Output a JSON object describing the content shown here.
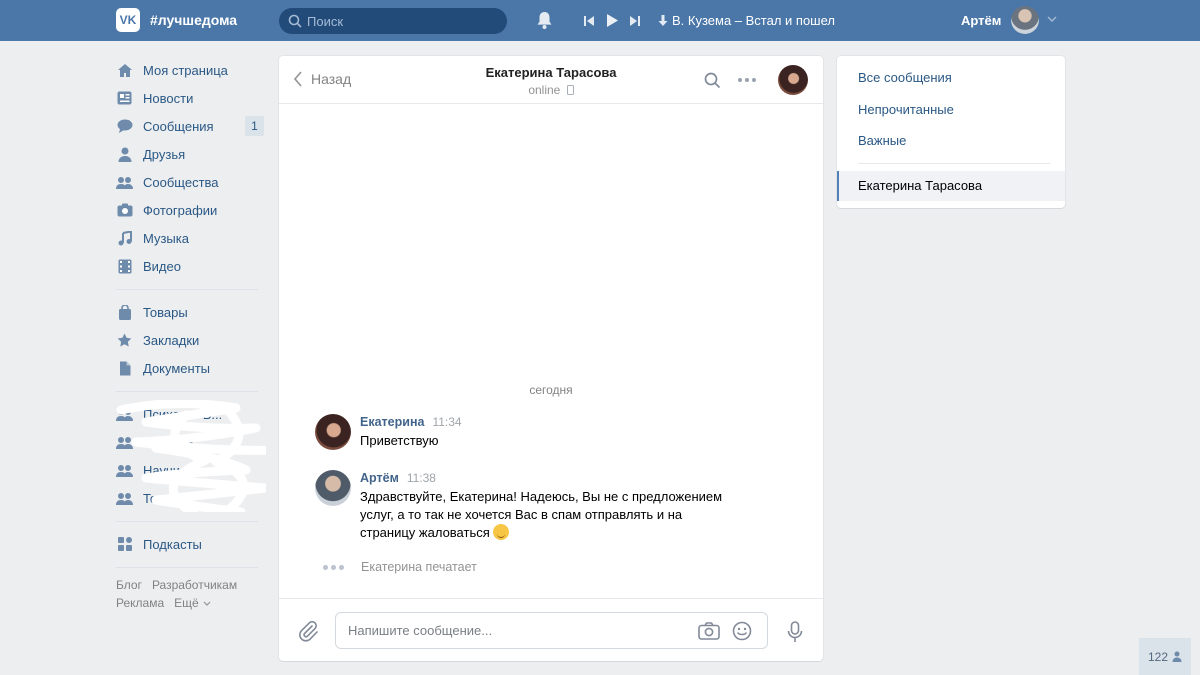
{
  "header": {
    "logo": "VK",
    "brand": "#лучшедома",
    "search_placeholder": "Поиск",
    "track": "В. Кузема – Встал и пошел",
    "user_name": "Артём"
  },
  "sidebar": {
    "items": [
      {
        "label": "Моя страница",
        "icon": "home-icon"
      },
      {
        "label": "Новости",
        "icon": "news-icon"
      },
      {
        "label": "Сообщения",
        "icon": "messages-icon",
        "count": "1"
      },
      {
        "label": "Друзья",
        "icon": "friends-icon"
      },
      {
        "label": "Сообщества",
        "icon": "communities-icon"
      },
      {
        "label": "Фотографии",
        "icon": "photos-icon"
      },
      {
        "label": "Музыка",
        "icon": "music-icon"
      },
      {
        "label": "Видео",
        "icon": "video-icon"
      }
    ],
    "items2": [
      {
        "label": "Товары",
        "icon": "market-icon"
      },
      {
        "label": "Закладки",
        "icon": "bookmarks-icon"
      },
      {
        "label": "Документы",
        "icon": "documents-icon"
      }
    ],
    "obscured": [
      {
        "label": "Психолог В..."
      },
      {
        "label": "Тон...ще..."
      },
      {
        "label": "Научись ..."
      },
      {
        "label": "То..."
      }
    ],
    "podcasts": "Подкасты",
    "footer": {
      "blog": "Блог",
      "developers": "Разработчикам",
      "ads": "Реклама",
      "more": "Ещё"
    }
  },
  "chat": {
    "back_label": "Назад",
    "peer_name": "Екатерина Тарасова",
    "peer_status": "online",
    "day": "сегодня",
    "messages": [
      {
        "author": "Екатерина",
        "time": "11:34",
        "text": "Приветствую"
      },
      {
        "author": "Артём",
        "time": "11:38",
        "text": "Здравствуйте, Екатерина! Надеюсь, Вы не с предложением услуг, а то так не хочется Вас в спам отправлять и на страницу жаловаться "
      }
    ],
    "typing": "Екатерина печатает",
    "input_placeholder": "Напишите сообщение..."
  },
  "rightpanel": {
    "all": "Все сообщения",
    "unread": "Непрочитанные",
    "important": "Важные",
    "active": "Екатерина Тарасова"
  },
  "online_count": "122",
  "colors": {
    "header": "#4a76a8",
    "link": "#2a5885",
    "accent": "#5181b8"
  }
}
